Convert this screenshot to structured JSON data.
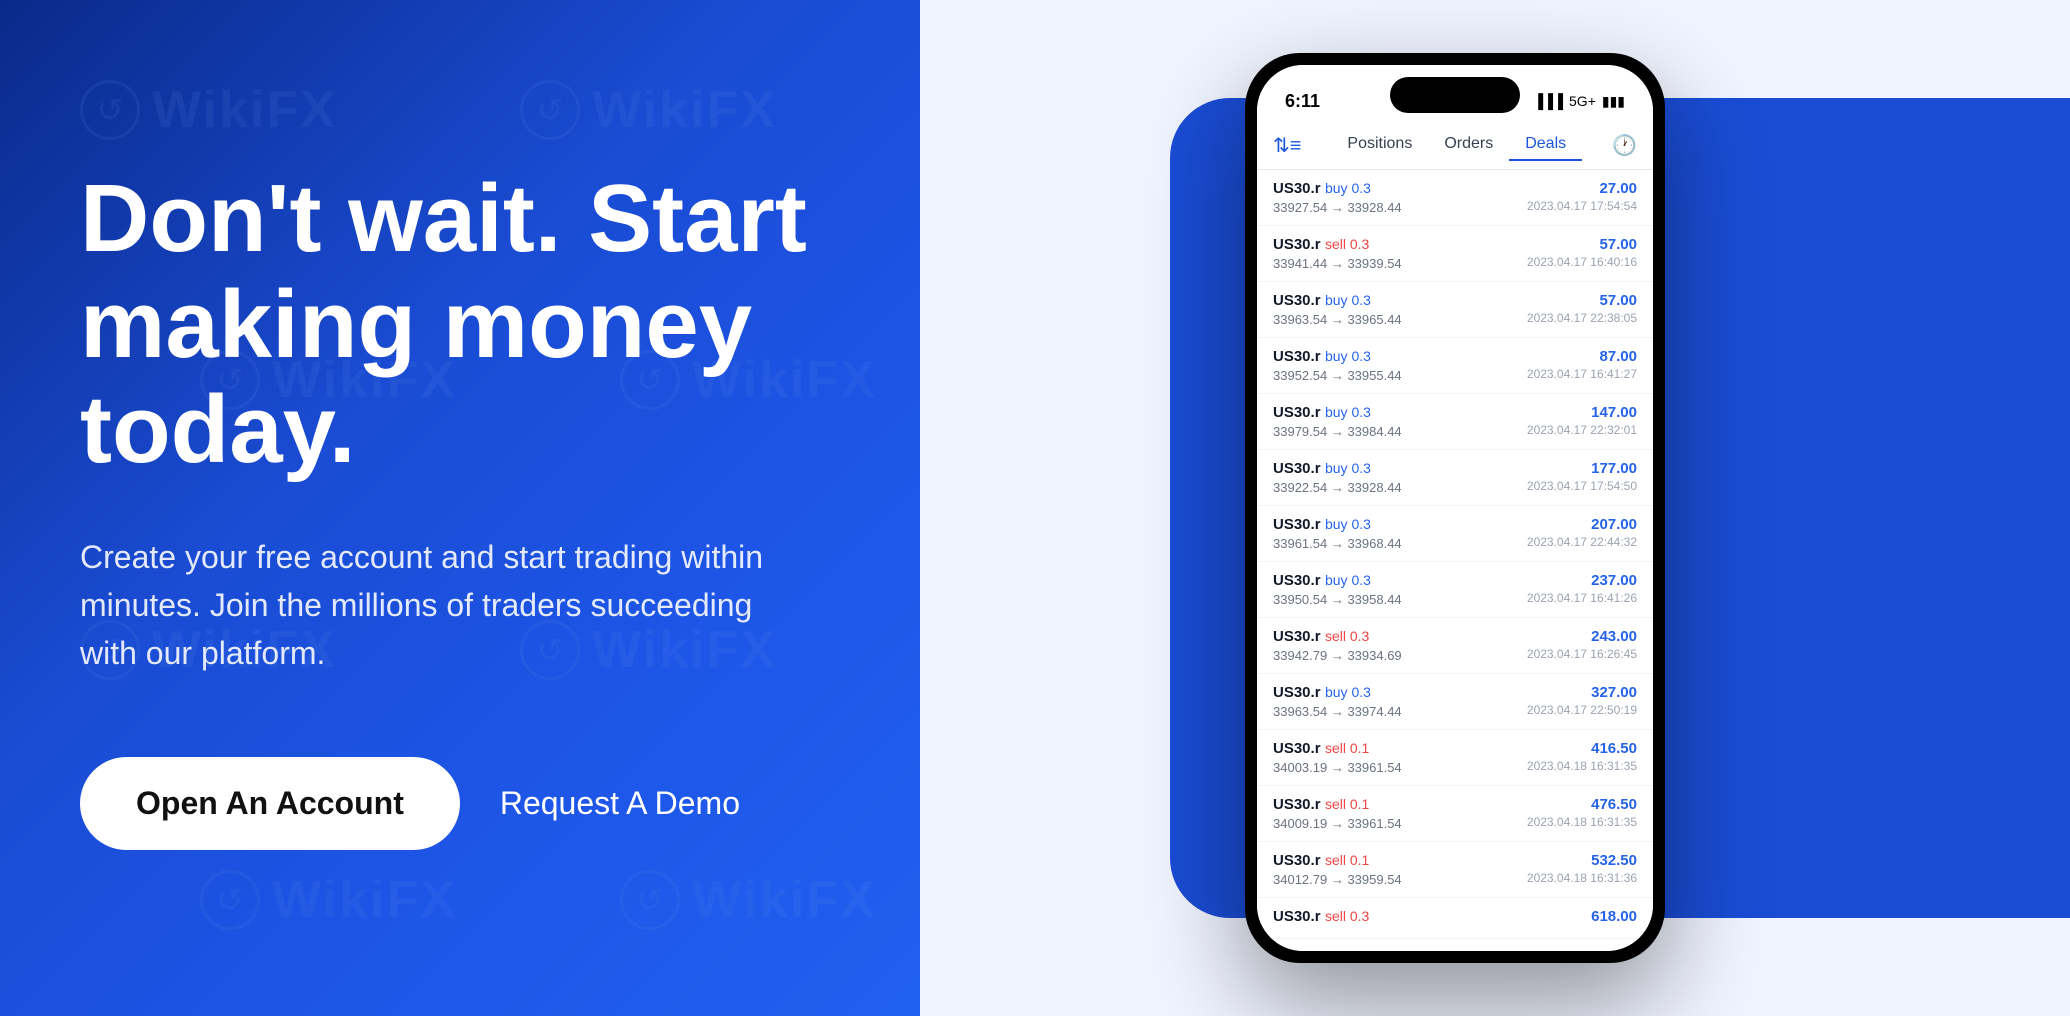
{
  "left": {
    "headline": "Don't wait. Start making money today.",
    "subtext": "Create your free account and start trading within minutes. Join the millions of traders succeeding with our platform.",
    "btn_primary": "Open An Account",
    "btn_secondary": "Request A Demo"
  },
  "phone": {
    "status_time": "6:11",
    "signal": "5G+",
    "tabs": [
      "Positions",
      "Orders",
      "Deals"
    ],
    "active_tab": "Deals",
    "trades": [
      {
        "symbol": "US30.r",
        "action": "buy",
        "qty": "0.3",
        "from": "33927.54",
        "to": "33928.44",
        "profit": "27.00",
        "time": "2023.04.17 17:54:54"
      },
      {
        "symbol": "US30.r",
        "action": "sell",
        "qty": "0.3",
        "from": "33941.44",
        "to": "33939.54",
        "profit": "57.00",
        "time": "2023.04.17 16:40:16"
      },
      {
        "symbol": "US30.r",
        "action": "buy",
        "qty": "0.3",
        "from": "33963.54",
        "to": "33965.44",
        "profit": "57.00",
        "time": "2023.04.17 22:38:05"
      },
      {
        "symbol": "US30.r",
        "action": "buy",
        "qty": "0.3",
        "from": "33952.54",
        "to": "33955.44",
        "profit": "87.00",
        "time": "2023.04.17 16:41:27"
      },
      {
        "symbol": "US30.r",
        "action": "buy",
        "qty": "0.3",
        "from": "33979.54",
        "to": "33984.44",
        "profit": "147.00",
        "time": "2023.04.17 22:32:01"
      },
      {
        "symbol": "US30.r",
        "action": "buy",
        "qty": "0.3",
        "from": "33922.54",
        "to": "33928.44",
        "profit": "177.00",
        "time": "2023.04.17 17:54:50"
      },
      {
        "symbol": "US30.r",
        "action": "buy",
        "qty": "0.3",
        "from": "33961.54",
        "to": "33968.44",
        "profit": "207.00",
        "time": "2023.04.17 22:44:32"
      },
      {
        "symbol": "US30.r",
        "action": "buy",
        "qty": "0.3",
        "from": "33950.54",
        "to": "33958.44",
        "profit": "237.00",
        "time": "2023.04.17 16:41:26"
      },
      {
        "symbol": "US30.r",
        "action": "sell",
        "qty": "0.3",
        "from": "33942.79",
        "to": "33934.69",
        "profit": "243.00",
        "time": "2023.04.17 16:26:45"
      },
      {
        "symbol": "US30.r",
        "action": "buy",
        "qty": "0.3",
        "from": "33963.54",
        "to": "33974.44",
        "profit": "327.00",
        "time": "2023.04.17 22:50:19"
      },
      {
        "symbol": "US30.r",
        "action": "sell",
        "qty": "0.1",
        "from": "34003.19",
        "to": "33961.54",
        "profit": "416.50",
        "time": "2023.04.18 16:31:35"
      },
      {
        "symbol": "US30.r",
        "action": "sell",
        "qty": "0.1",
        "from": "34009.19",
        "to": "33961.54",
        "profit": "476.50",
        "time": "2023.04.18 16:31:35"
      },
      {
        "symbol": "US30.r",
        "action": "sell",
        "qty": "0.1",
        "from": "34012.79",
        "to": "33959.54",
        "profit": "532.50",
        "time": "2023.04.18 16:31:36"
      },
      {
        "symbol": "US30.r",
        "action": "sell",
        "qty": "0.3",
        "from": "",
        "to": "",
        "profit": "618.00",
        "time": ""
      }
    ]
  },
  "brand": {
    "name": "WikiFX",
    "watermark_text": "WikiFX"
  }
}
